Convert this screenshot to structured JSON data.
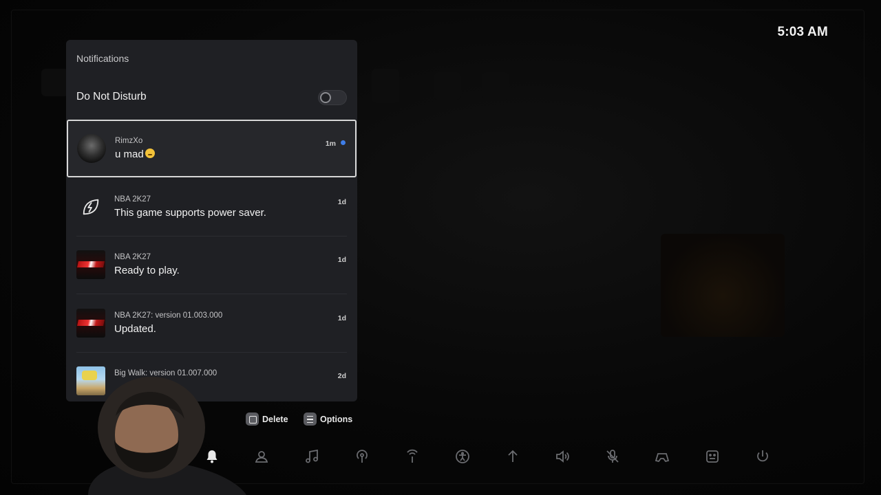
{
  "clock": "5:03 AM",
  "panel": {
    "title": "Notifications",
    "dnd_label": "Do Not Disturb",
    "dnd_enabled": false
  },
  "notifications": [
    {
      "source": "RimzXo",
      "message": "u mad",
      "time": "1m",
      "unread": true,
      "thumb": "avatar-skull"
    },
    {
      "source": "NBA 2K27",
      "message": "This game supports power saver.",
      "time": "1d",
      "unread": false,
      "thumb": "power-saver-icon"
    },
    {
      "source": "NBA 2K27",
      "message": "Ready to play.",
      "time": "1d",
      "unread": false,
      "thumb": "nba2k27-thumbnail"
    },
    {
      "source": "NBA 2K27: version 01.003.000",
      "message": "Updated.",
      "time": "1d",
      "unread": false,
      "thumb": "nba2k27-thumbnail"
    },
    {
      "source": "Big Walk: version 01.007.000",
      "message": "",
      "time": "2d",
      "unread": false,
      "thumb": "big-walk-thumbnail"
    }
  ],
  "actions": {
    "delete_label": "Delete",
    "options_label": "Options"
  },
  "control_center": [
    "bell-icon",
    "game-base-icon",
    "music-icon",
    "broadcast-icon",
    "remote-play-icon",
    "accessibility-icon",
    "network-warning-icon",
    "speaker-icon",
    "mic-muted-icon",
    "controller-icon",
    "profile-icon",
    "power-icon"
  ],
  "colors": {
    "panel_bg": "#1f2024",
    "unread_dot": "#3f7ee8",
    "selected_border": "#d8d8d8"
  }
}
